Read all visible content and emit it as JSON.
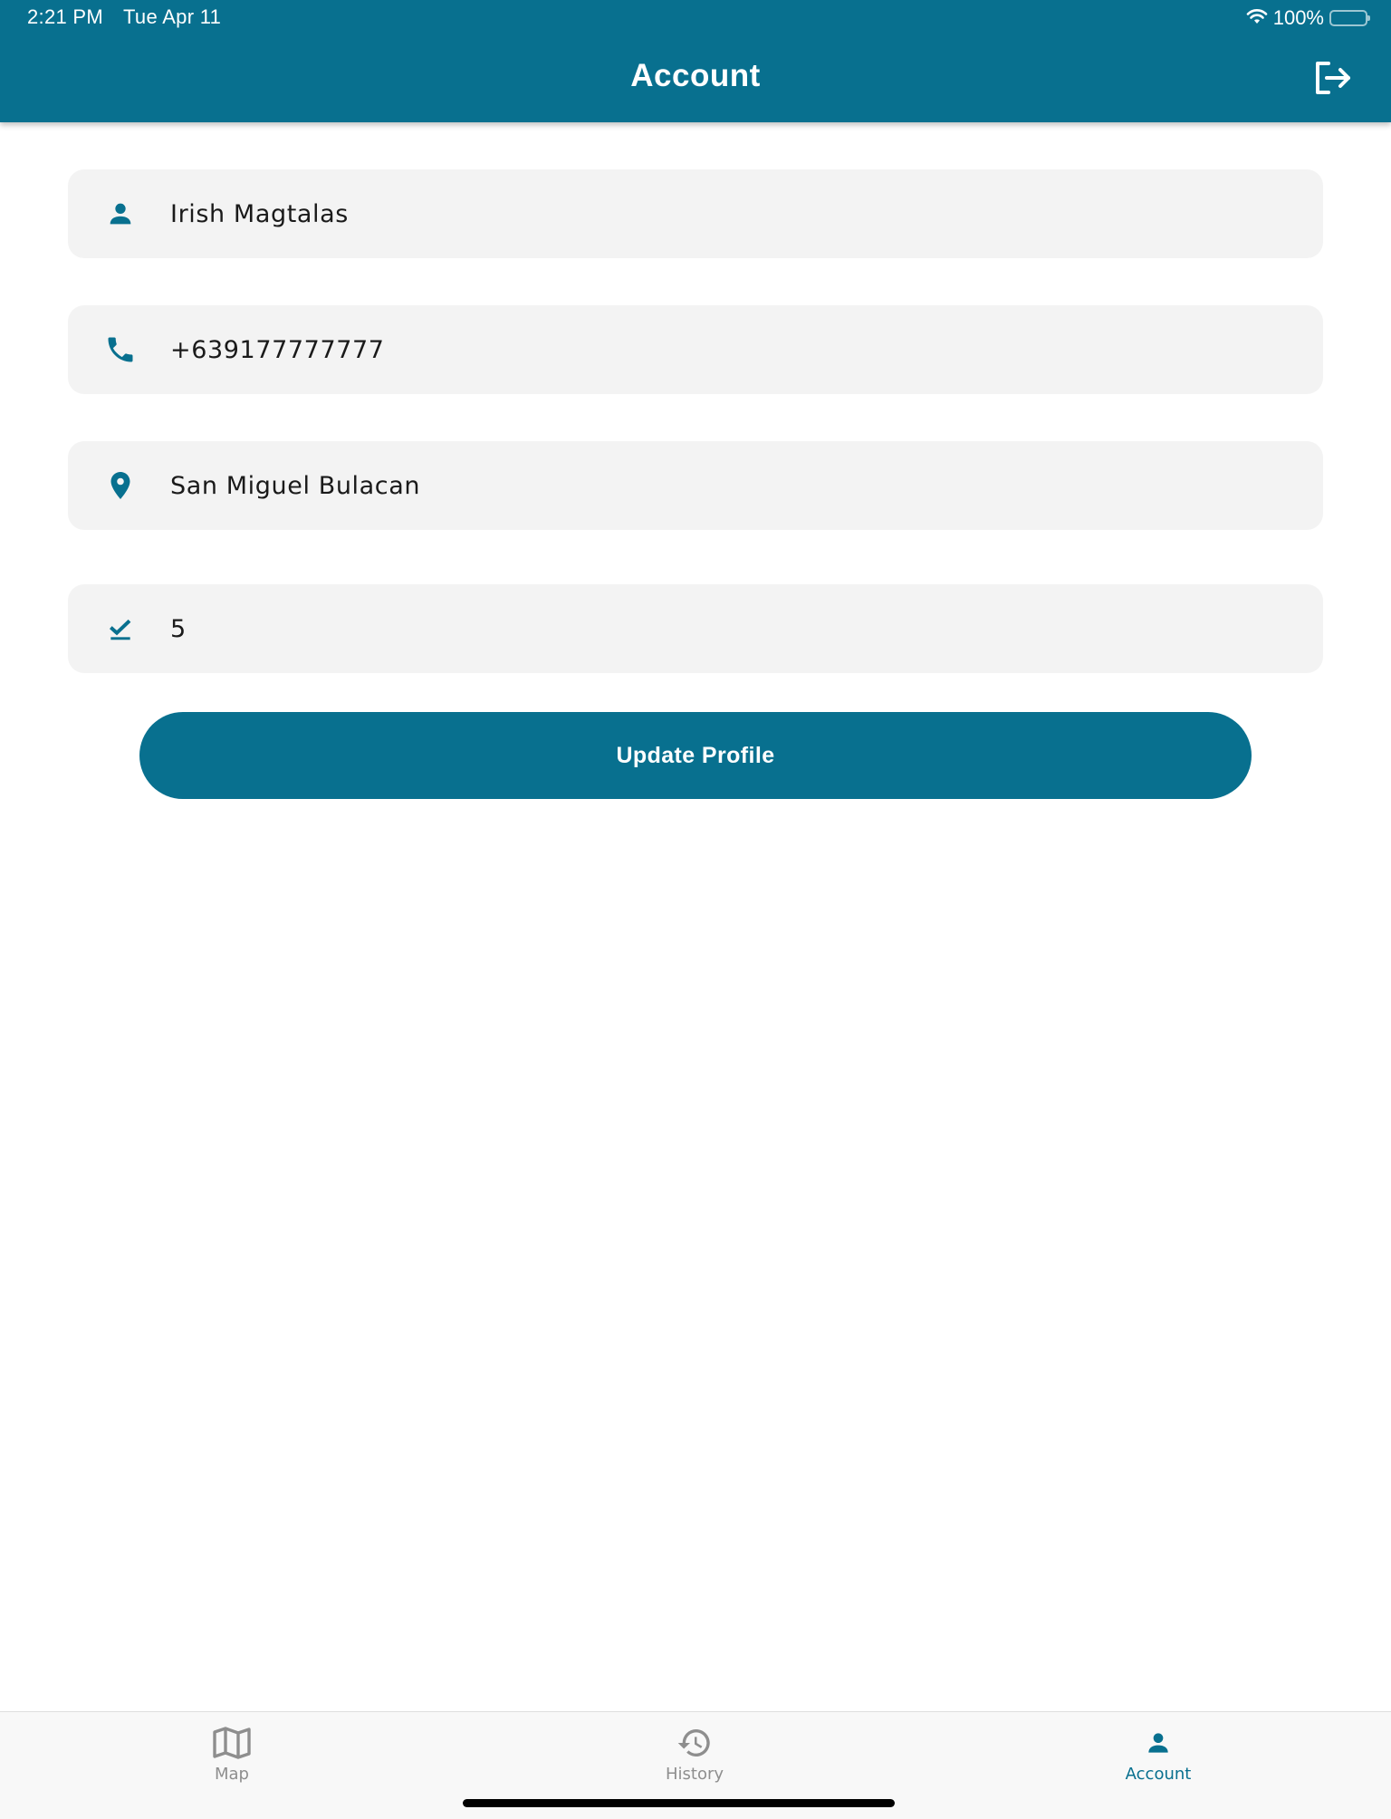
{
  "status_bar": {
    "time": "2:21 PM",
    "date": "Tue Apr 11",
    "battery": "100%",
    "battery_level": 1.0,
    "wifi_icon": "wifi-icon"
  },
  "header": {
    "title": "Account",
    "logout_icon": "logout-icon"
  },
  "form": {
    "fields": [
      {
        "name": "name",
        "icon": "person-icon",
        "value": "Irish Magtalas"
      },
      {
        "name": "phone",
        "icon": "phone-icon",
        "value": "+639177777777"
      },
      {
        "name": "address",
        "icon": "location-pin-icon",
        "value": "San Miguel Bulacan"
      },
      {
        "name": "count",
        "icon": "check-underline-icon",
        "value": "5"
      }
    ],
    "submit_label": "Update Profile"
  },
  "tabbar": {
    "tabs": [
      {
        "label": "Map",
        "icon": "map-icon",
        "active": false
      },
      {
        "label": "History",
        "icon": "history-icon",
        "active": false
      },
      {
        "label": "Account",
        "icon": "person-icon",
        "active": true
      }
    ]
  },
  "colors": {
    "brand": "#08708f",
    "field_bg": "#f3f3f3",
    "tab_inactive": "#8e8e8e",
    "tabbar_bg": "#f8f8f8"
  }
}
